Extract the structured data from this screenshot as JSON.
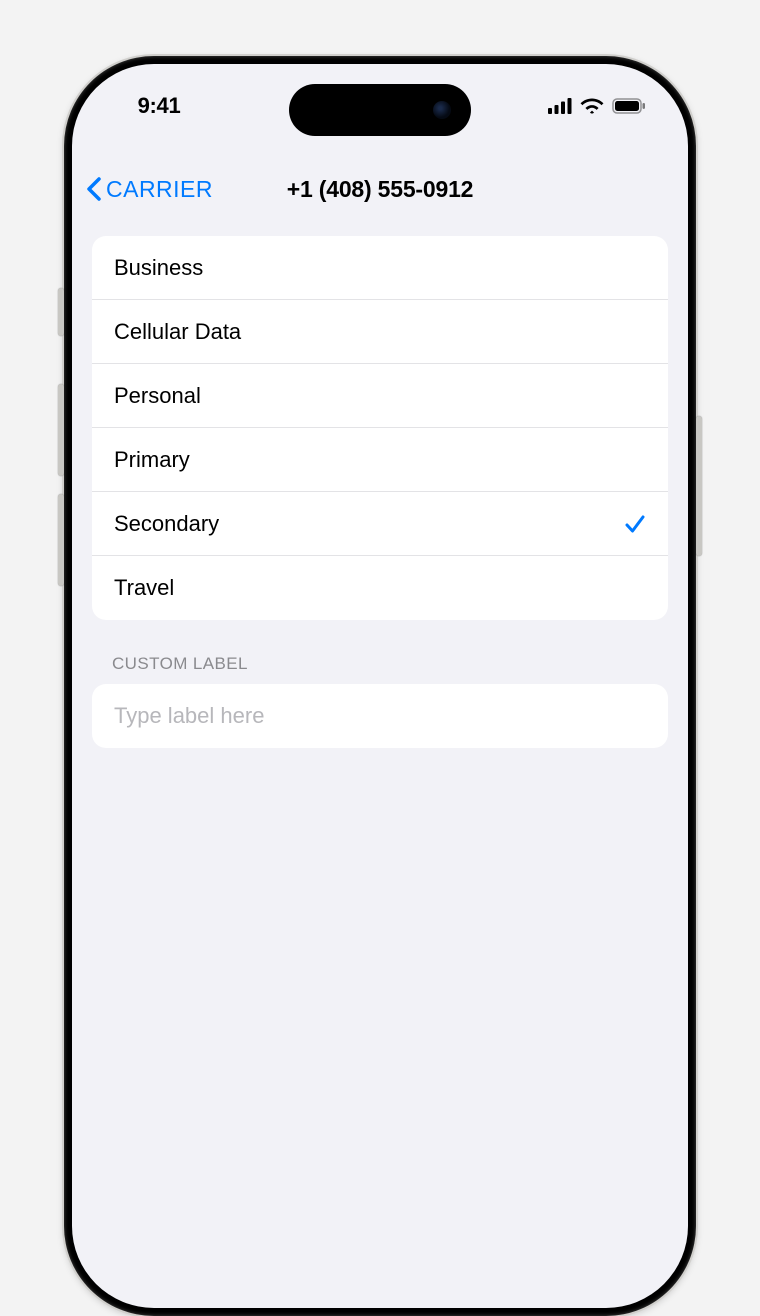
{
  "status": {
    "time": "9:41"
  },
  "nav": {
    "back_label": "CARRIER",
    "title": "+1 (408) 555-0912"
  },
  "labels": [
    {
      "text": "Business",
      "selected": false
    },
    {
      "text": "Cellular Data",
      "selected": false
    },
    {
      "text": "Personal",
      "selected": false
    },
    {
      "text": "Primary",
      "selected": false
    },
    {
      "text": "Secondary",
      "selected": true
    },
    {
      "text": "Travel",
      "selected": false
    }
  ],
  "custom": {
    "header": "CUSTOM LABEL",
    "placeholder": "Type label here",
    "value": ""
  }
}
